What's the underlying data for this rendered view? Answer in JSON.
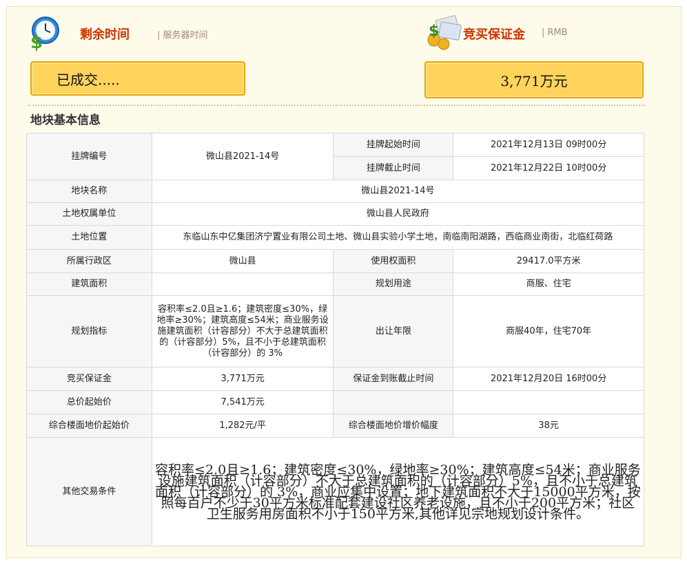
{
  "header": {
    "left_title": "剩余时间",
    "left_sub": "| 服务器时间",
    "right_title": "竞买保证金",
    "right_sub": "| RMB",
    "left_icon": "clock-icon",
    "right_icon": "money-icon"
  },
  "status": {
    "left_value": "已成交.....",
    "right_value": "3,771万元"
  },
  "section": {
    "title": "地块基本信息"
  },
  "table": {
    "code_label": "挂牌编号",
    "code_value": "微山县2021-14号",
    "start_label": "挂牌起始时间",
    "start_value": "2021年12月13日 09时00分",
    "end_label": "挂牌截止时间",
    "end_value": "2021年12月22日 10时00分",
    "name_label": "地块名称",
    "name_value": "微山县2021-14号",
    "owner_label": "土地权属单位",
    "owner_value": "微山县人民政府",
    "location_label": "土地位置",
    "location_value": "东临山东中亿集团济宁置业有限公司土地、微山县实验小学土地，南临南阳湖路，西临商业南街，北临红荷路",
    "district_label": "所属行政区",
    "district_value": "微山县",
    "use_area_label": "使用权面积",
    "use_area_value": "29417.0平方米",
    "build_area_label": "建筑面积",
    "build_area_value": "",
    "purpose_label": "规划用途",
    "purpose_value": "商服、住宅",
    "plan_label": "规划指标",
    "plan_value": "容积率≤2.0且≥1.6；建筑密度≤30%，绿地率≥30%；建筑高度≤54米；商业服务设施建筑面积（计容部分）不大于总建筑面积的（计容部分）5%，且不小于总建筑面积（计容部分）的 3%",
    "term_label": "出让年限",
    "term_value": "商服40年，住宅70年",
    "deposit_label": "竞买保证金",
    "deposit_value": "3,771万元",
    "deposit_deadline_label": "保证金到账截止时间",
    "deposit_deadline_value": "2021年12月20日 16时00分",
    "total_price_label": "总价起始价",
    "total_price_value": "7,541万元",
    "floor_price_label": "综合楼面地价起始价",
    "floor_price_value": "1,282元/平",
    "increment_label": "综合楼面地价增价幅度",
    "increment_value": "38元",
    "other_label": "其他交易条件",
    "other_value": "容积率≤2.0且≥1.6；建筑密度≤30%，绿地率≥30%；建筑高度≤54米；商业服务设施建筑面积（计容部分）不大于总建筑面积的（计容部分）5%，且不小于总建筑面积（计容部分）的 3%，商业应集中设置；地下建筑面积不大于15000平方米，按照每百户不少于30平方米标准配套建设社区养老设施，且不小于200平方米；社区卫生服务用房面积不小于150平方米,其他详见宗地规划设计条件。"
  }
}
